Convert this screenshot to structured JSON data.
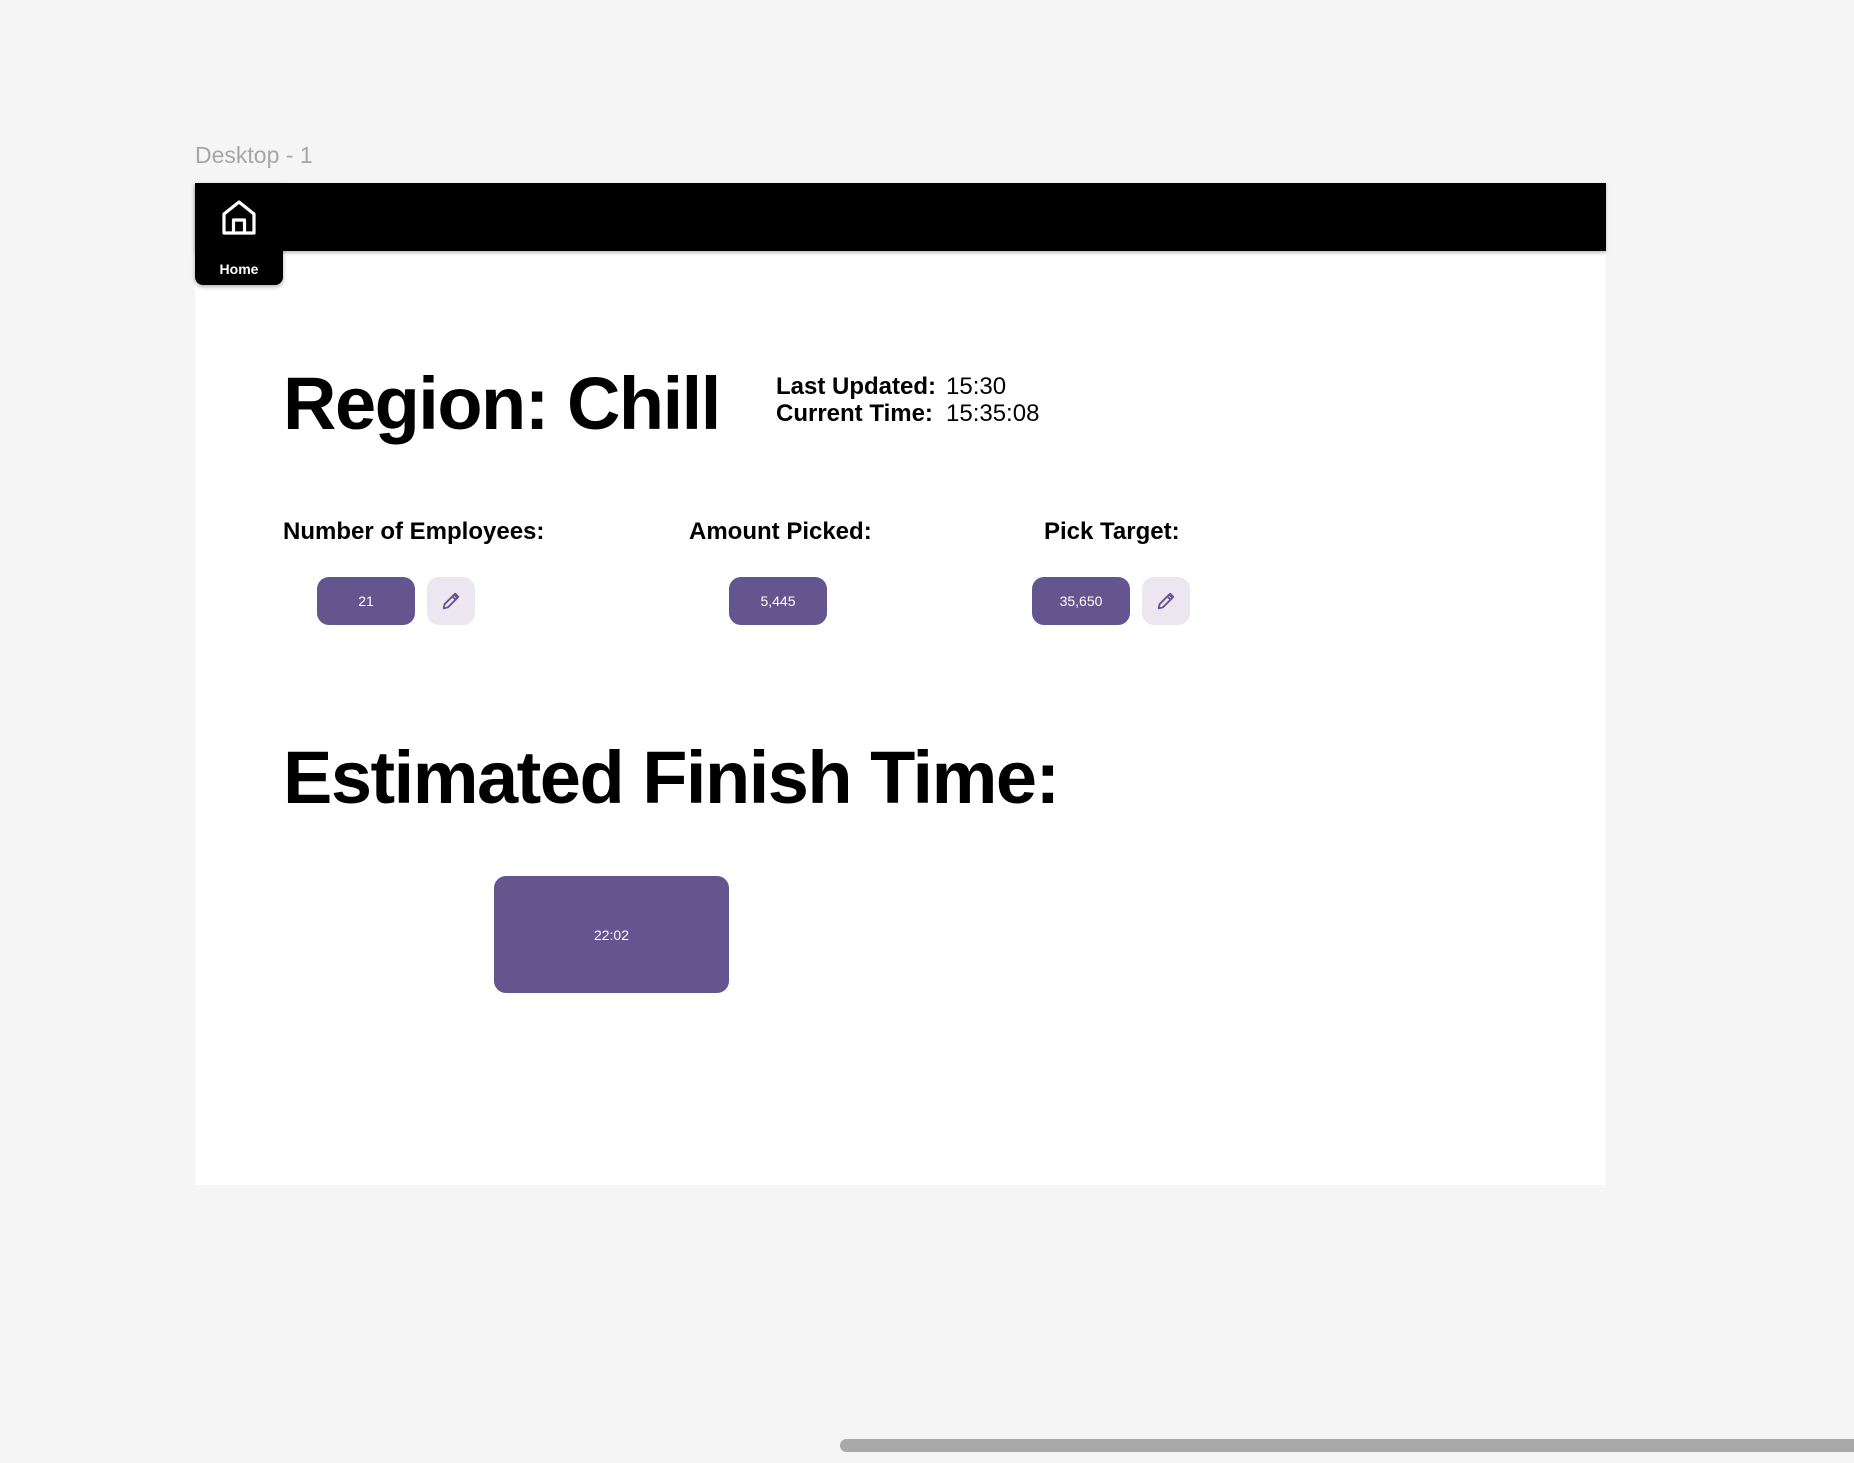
{
  "canvas": {
    "frame_label": "Desktop - 1"
  },
  "nav": {
    "home_label": "Home",
    "home_icon": "home-icon"
  },
  "header": {
    "region_title": "Region: Chill",
    "last_updated_label": "Last Updated:",
    "last_updated_value": "15:30",
    "current_time_label": "Current Time:",
    "current_time_value": "15:35:08"
  },
  "metrics": {
    "employees": {
      "label": "Number of Employees:",
      "value": "21",
      "edit_icon": "pencil-icon"
    },
    "picked": {
      "label": "Amount Picked:",
      "value": "5,445"
    },
    "target": {
      "label": "Pick Target:",
      "value": "35,650",
      "edit_icon": "pencil-icon"
    }
  },
  "finish": {
    "title": "Estimated Finish Time:",
    "value": "22:02"
  },
  "colors": {
    "accent": "#65558f",
    "edit_button_bg": "#ece6f0",
    "topbar": "#000000",
    "canvas_bg": "#f5f5f5"
  }
}
